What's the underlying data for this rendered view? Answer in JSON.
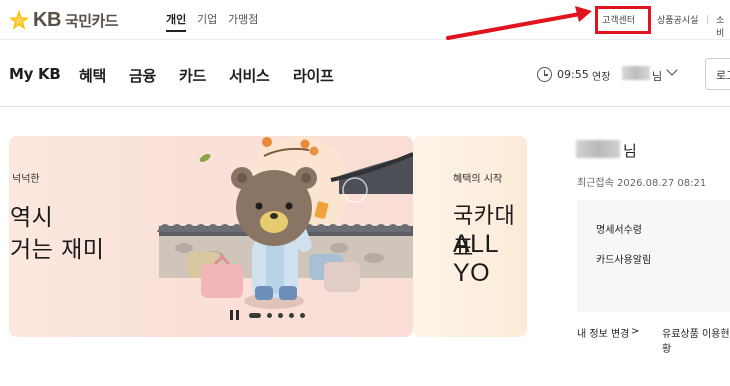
{
  "header": {
    "logo_kb": "KB",
    "logo_name": "국민카드",
    "segments": [
      "개인",
      "기업",
      "가맹점"
    ],
    "utility": [
      "고객센터",
      "상품공시실",
      "소비"
    ]
  },
  "nav": {
    "items": [
      "My KB",
      "혜택",
      "금융",
      "카드",
      "서비스",
      "라이프"
    ],
    "session_time": "09:55",
    "extend_label": "연장",
    "user_suffix": "님",
    "logout_label": "로그"
  },
  "banner1": {
    "kicker": "넉넉한",
    "title_line1": "역시",
    "title_line2": "거는 재미"
  },
  "banner2": {
    "kicker": "혜택의 시작",
    "title_line1": "국카대표",
    "title_line2": "ALL YO"
  },
  "profile": {
    "suffix": "님",
    "last_login": "최근접속 2026.08.27 08:21",
    "quick": [
      "명세서수령",
      "카드사용알림"
    ],
    "links": [
      "내 정보 변경",
      "유료상품 이용현황"
    ]
  },
  "colors": {
    "highlight": "#e0141e",
    "kb_yellow": "#ffbc00",
    "kb_brown": "#5b5046"
  }
}
